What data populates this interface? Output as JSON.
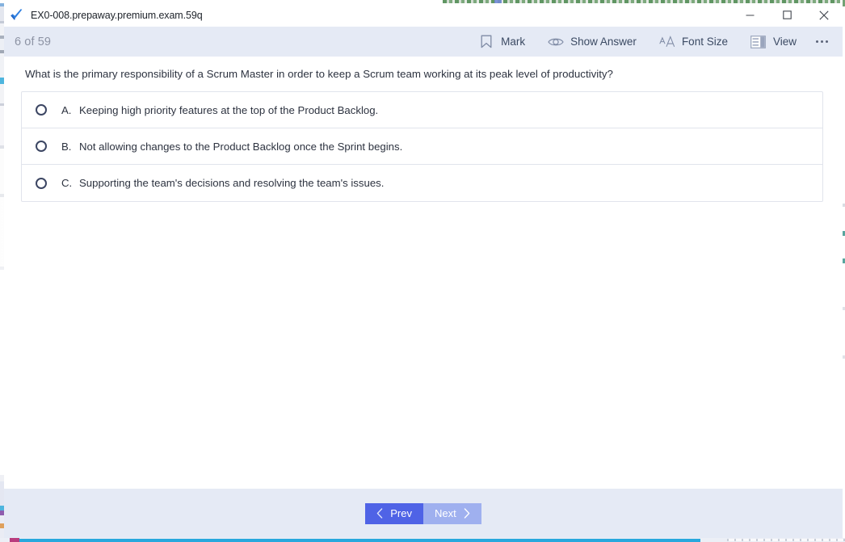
{
  "window": {
    "title": "EX0-008.prepaway.premium.exam.59q",
    "app_icon": "blue-checkmark-icon",
    "controls": {
      "minimize": "Minimize",
      "maximize": "Maximize",
      "close": "Close"
    }
  },
  "toolbar": {
    "counter": "6 of 59",
    "current_question": 6,
    "total_questions": 59,
    "items": [
      {
        "label": "Mark",
        "icon": "bookmark-icon"
      },
      {
        "label": "Show Answer",
        "icon": "eye-icon"
      },
      {
        "label": "Font Size",
        "icon": "font-size-icon"
      },
      {
        "label": "View",
        "icon": "view-layout-icon"
      }
    ],
    "overflow": "more-options-icon"
  },
  "question": {
    "text": "What is the primary responsibility of a Scrum Master in order to keep a Scrum team working at its peak level of productivity?",
    "options": [
      {
        "letter": "A.",
        "text": "Keeping high priority features at the top of the Product Backlog.",
        "selected": false
      },
      {
        "letter": "B.",
        "text": "Not allowing changes to the Product Backlog once the Sprint begins.",
        "selected": false
      },
      {
        "letter": "C.",
        "text": "Supporting the team's decisions and resolving the team's issues.",
        "selected": false
      }
    ]
  },
  "footer": {
    "prev_label": "Prev",
    "next_label": "Next",
    "prev_icon": "chevron-left-icon",
    "next_icon": "chevron-right-icon"
  },
  "colors": {
    "toolbar_bg": "#e5eaf5",
    "prev_button": "#4f63e6",
    "next_button": "#9fb0ef",
    "text": "#2d3340",
    "counter_text": "#8d93a4",
    "border": "#e1e4ec"
  }
}
